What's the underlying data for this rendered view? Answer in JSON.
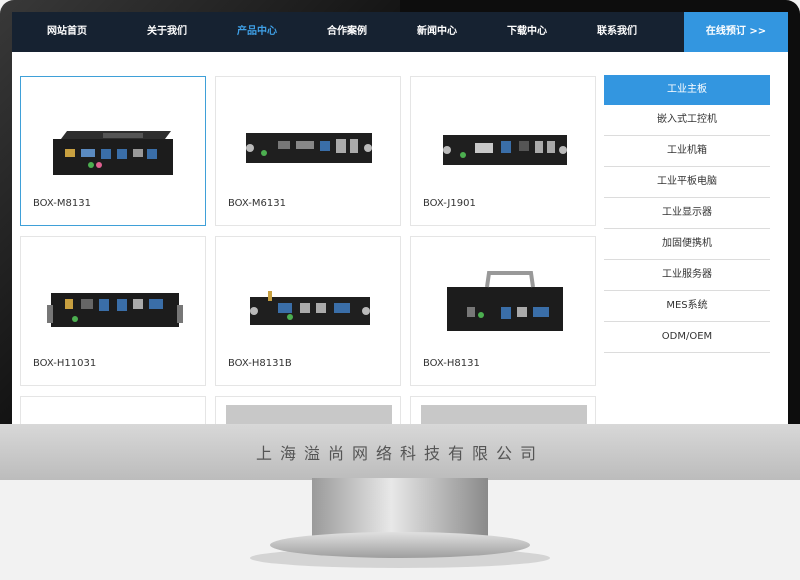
{
  "nav": {
    "items": [
      {
        "label": "网站首页"
      },
      {
        "label": "关于我们"
      },
      {
        "label": "产品中心"
      },
      {
        "label": "合作案例"
      },
      {
        "label": "新闻中心"
      },
      {
        "label": "下载中心"
      },
      {
        "label": "联系我们"
      }
    ],
    "active_index": 2,
    "cta_label": "在线预订 >>"
  },
  "products": [
    {
      "name": "BOX-M8131"
    },
    {
      "name": "BOX-M6131"
    },
    {
      "name": "BOX-J1901"
    },
    {
      "name": "BOX-H11031"
    },
    {
      "name": "BOX-H8131B"
    },
    {
      "name": "BOX-H8131"
    }
  ],
  "sidebar": {
    "header": "工业主板",
    "items": [
      {
        "label": "嵌入式工控机"
      },
      {
        "label": "工业机箱"
      },
      {
        "label": "工业平板电脑"
      },
      {
        "label": "工业显示器"
      },
      {
        "label": "加固便携机"
      },
      {
        "label": "工业服务器"
      },
      {
        "label": "MES系统"
      },
      {
        "label": "ODM/OEM"
      }
    ]
  },
  "footer": {
    "company": "上海溢尚网络科技有限公司"
  },
  "colors": {
    "nav_bg": "#162231",
    "accent": "#3396e0",
    "active_nav": "#3fa0e6"
  }
}
